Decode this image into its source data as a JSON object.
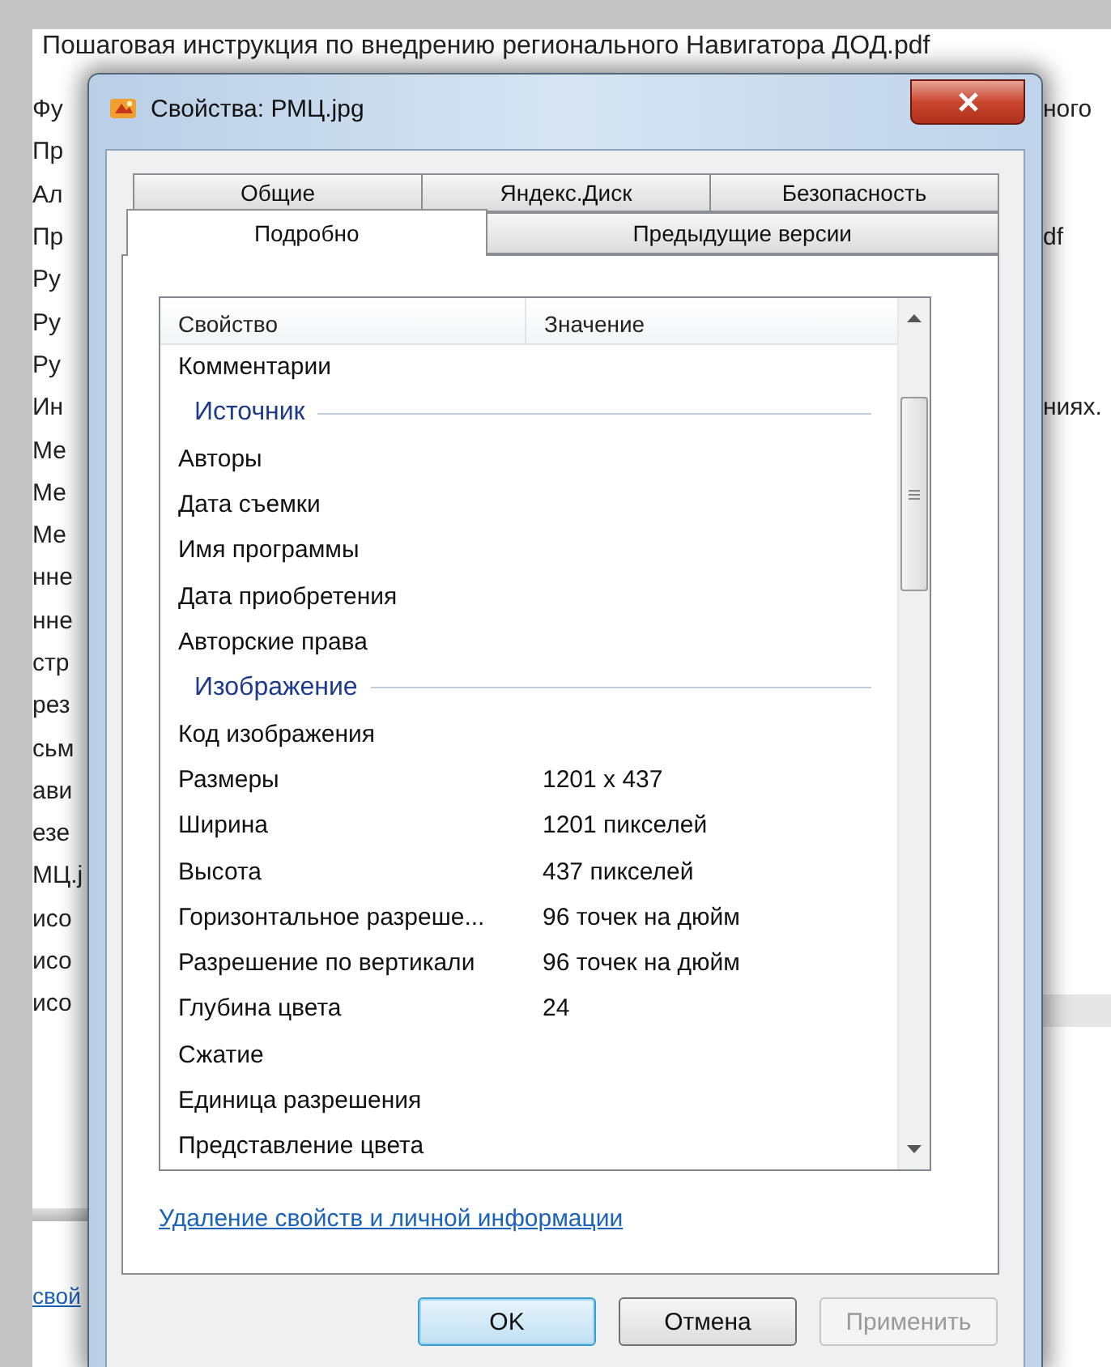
{
  "background": {
    "title_row": "Пошаговая инструкция по внедрению регионального Навигатора ДОД.pdf",
    "rows": [
      {
        "left": "Фу",
        "right": "ного"
      },
      {
        "left": "Пр"
      },
      {
        "left": "Ал"
      },
      {
        "left": "Пр",
        "right": "df"
      },
      {
        "left": "Ру"
      },
      {
        "left": "Ру"
      },
      {
        "left": "Ру"
      },
      {
        "left": "Ин",
        "right": "ниях."
      },
      {
        "left": "Ме"
      },
      {
        "left": "Ме"
      },
      {
        "left": "Ме"
      },
      {
        "left": "нне"
      },
      {
        "left": "нне"
      },
      {
        "left": "стр"
      },
      {
        "left": "рез"
      },
      {
        "left": "сьм"
      },
      {
        "left": "ави"
      },
      {
        "left": "езе"
      },
      {
        "left": "МЦ.j"
      },
      {
        "left": "исо"
      },
      {
        "left": "исо"
      },
      {
        "left": "исо"
      }
    ],
    "link": "свой"
  },
  "dialog": {
    "title": "Свойства: РМЦ.jpg",
    "tab_rows": [
      [
        {
          "label": "Общие",
          "selected": false
        },
        {
          "label": "Яндекс.Диск",
          "selected": false
        },
        {
          "label": "Безопасность",
          "selected": false
        }
      ],
      [
        {
          "label": "Подробно",
          "selected": true
        },
        {
          "label": "Предыдущие версии",
          "selected": false
        }
      ]
    ],
    "columns": [
      "Свойство",
      "Значение"
    ],
    "rows": [
      {
        "kind": "property",
        "name": "Комментарии"
      },
      {
        "kind": "group",
        "name": "Источник"
      },
      {
        "kind": "property",
        "name": "Авторы"
      },
      {
        "kind": "property",
        "name": "Дата съемки"
      },
      {
        "kind": "property",
        "name": "Имя программы"
      },
      {
        "kind": "property",
        "name": "Дата приобретения"
      },
      {
        "kind": "property",
        "name": "Авторские права"
      },
      {
        "kind": "group",
        "name": "Изображение"
      },
      {
        "kind": "property",
        "name": "Код изображения"
      },
      {
        "kind": "property",
        "name": "Размеры",
        "value": "1201 x 437"
      },
      {
        "kind": "property",
        "name": "Ширина",
        "value": "1201 пикселей"
      },
      {
        "kind": "property",
        "name": "Высота",
        "value": "437 пикселей"
      },
      {
        "kind": "property",
        "name": "Горизонтальное разреше...",
        "value": "96 точек на дюйм"
      },
      {
        "kind": "property",
        "name": "Разрешение по вертикали",
        "value": "96 точек на дюйм"
      },
      {
        "kind": "property",
        "name": "Глубина цвета",
        "value": "24"
      },
      {
        "kind": "property",
        "name": "Сжатие"
      },
      {
        "kind": "property",
        "name": "Единица разрешения"
      },
      {
        "kind": "property",
        "name": "Представление цвета"
      }
    ],
    "link": "Удаление свойств и личной информации",
    "buttons": [
      {
        "label": "OK",
        "default": true,
        "disabled": false
      },
      {
        "label": "Отмена",
        "default": false,
        "disabled": false
      },
      {
        "label": "Применить",
        "default": false,
        "disabled": true
      }
    ]
  }
}
